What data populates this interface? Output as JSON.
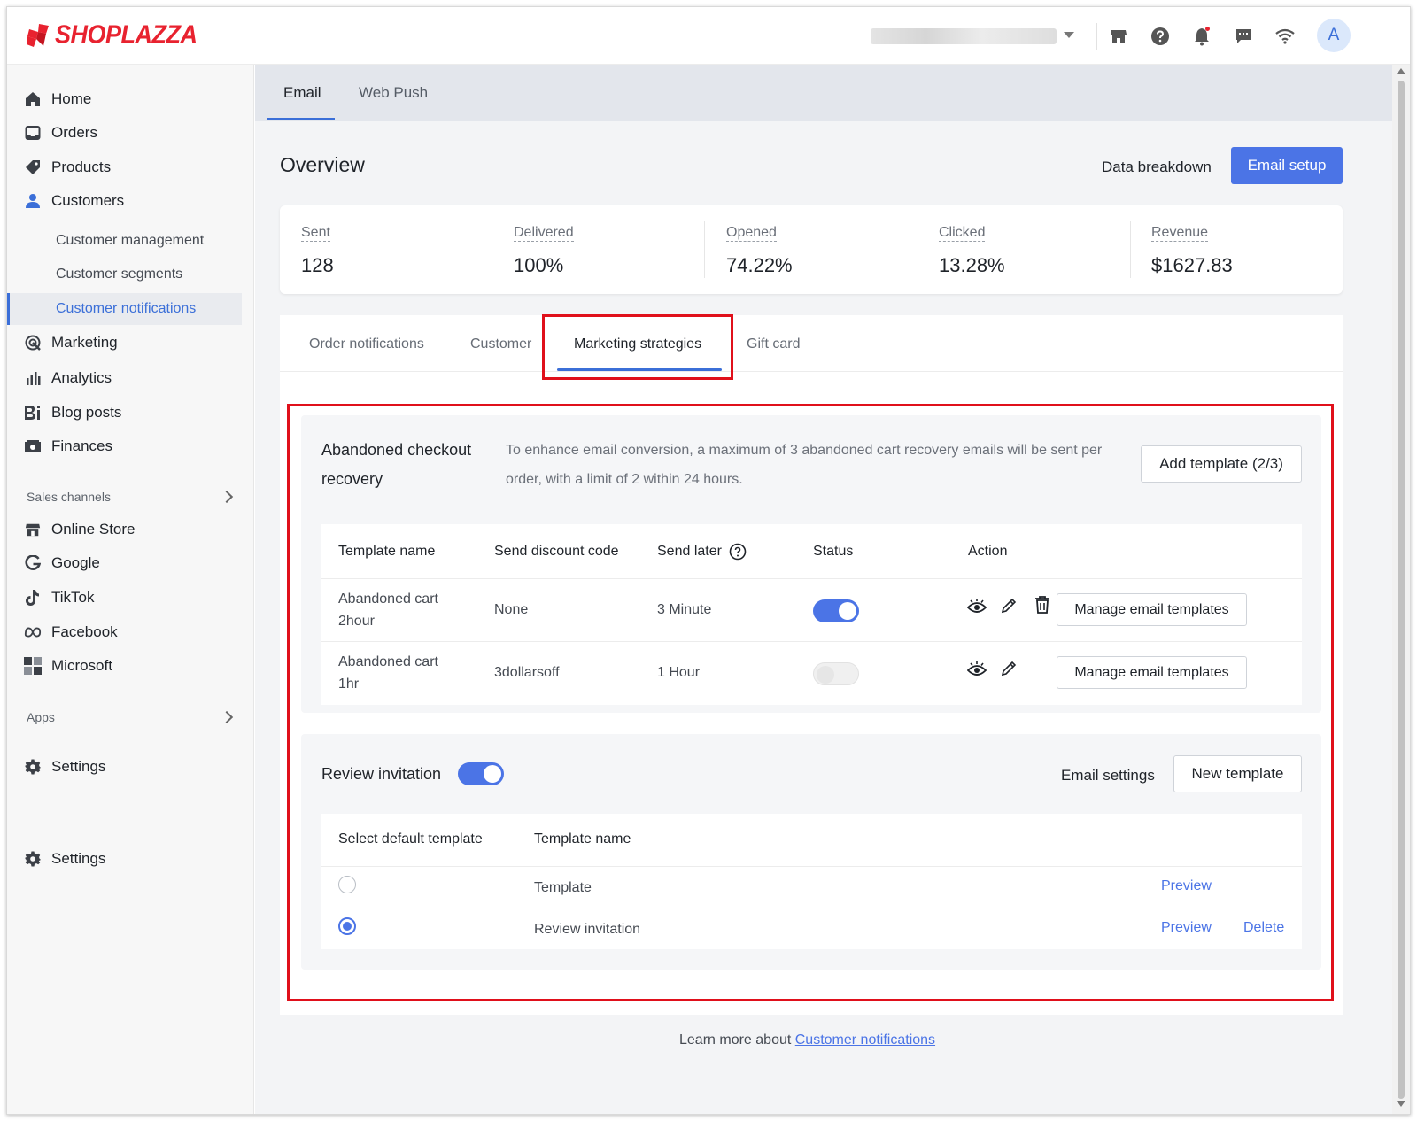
{
  "app": {
    "brand": "SHOPLAZZA",
    "colors": {
      "brand_red": "#e8222f",
      "accent_blue": "#4b74e6",
      "highlight_red": "#e0101b"
    }
  },
  "topbar": {
    "avatar_initial": "A",
    "icons": [
      "store-icon",
      "help-icon",
      "bell-icon",
      "chat-icon",
      "wifi-icon"
    ]
  },
  "sidebar": {
    "items": [
      {
        "label": "Home",
        "icon": "home-icon"
      },
      {
        "label": "Orders",
        "icon": "inbox-icon"
      },
      {
        "label": "Products",
        "icon": "tag-icon"
      },
      {
        "label": "Customers",
        "icon": "person-icon"
      }
    ],
    "customer_sub": [
      {
        "label": "Customer management"
      },
      {
        "label": "Customer segments"
      },
      {
        "label": "Customer notifications",
        "active": true
      }
    ],
    "items2": [
      {
        "label": "Marketing",
        "icon": "marketing-icon"
      },
      {
        "label": "Analytics",
        "icon": "analytics-icon"
      },
      {
        "label": "Blog posts",
        "icon": "blog-icon"
      },
      {
        "label": "Finances",
        "icon": "finances-icon"
      }
    ],
    "sales_channels_label": "Sales channels",
    "channels": [
      {
        "label": "Online Store",
        "icon": "store-icon"
      },
      {
        "label": "Google",
        "icon": "google-icon"
      },
      {
        "label": "TikTok",
        "icon": "tiktok-icon"
      },
      {
        "label": "Facebook",
        "icon": "meta-icon"
      },
      {
        "label": "Microsoft",
        "icon": "microsoft-icon"
      }
    ],
    "apps_label": "Apps",
    "settings_label": "Settings",
    "settings_label_2": "Settings"
  },
  "main": {
    "tabs": [
      {
        "label": "Email",
        "active": true
      },
      {
        "label": "Web Push"
      }
    ],
    "overview_title": "Overview",
    "data_breakdown": "Data breakdown",
    "email_setup": "Email setup",
    "stats": [
      {
        "label": "Sent",
        "value": "128"
      },
      {
        "label": "Delivered",
        "value": "100%"
      },
      {
        "label": "Opened",
        "value": "74.22%"
      },
      {
        "label": "Clicked",
        "value": "13.28%"
      },
      {
        "label": "Revenue",
        "value": "$1627.83"
      }
    ],
    "subtabs": [
      {
        "label": "Order notifications"
      },
      {
        "label": "Customer"
      },
      {
        "label": "Marketing strategies",
        "active": true
      },
      {
        "label": "Gift card"
      }
    ],
    "abandoned": {
      "title_line1": "Abandoned checkout",
      "title_line2": "recovery",
      "desc_line1": "To enhance email conversion, a maximum of 3 abandoned cart recovery emails will be sent per",
      "desc_line2": "order, with a limit of 2 within 24 hours.",
      "add_template": "Add template (2/3)",
      "headers": {
        "template_name": "Template name",
        "send_discount": "Send discount code",
        "send_later": "Send later",
        "status": "Status",
        "action": "Action"
      },
      "rows": [
        {
          "name_line1": "Abandoned cart",
          "name_line2": "2hour",
          "discount": "None",
          "later": "3 Minute",
          "enabled": true,
          "manage": "Manage email templates"
        },
        {
          "name_line1": "Abandoned cart",
          "name_line2": "1hr",
          "discount": "3dollarsoff",
          "later": "1 Hour",
          "enabled": false,
          "manage": "Manage email templates"
        }
      ]
    },
    "review": {
      "title": "Review invitation",
      "enabled": true,
      "email_settings": "Email settings",
      "new_template": "New template",
      "headers": {
        "select_default": "Select default template",
        "template_name": "Template name"
      },
      "rows": [
        {
          "name": "Template",
          "selected": false,
          "preview": "Preview"
        },
        {
          "name": "Review invitation",
          "selected": true,
          "preview": "Preview",
          "delete": "Delete"
        }
      ]
    },
    "footer": {
      "prefix": "Learn more about ",
      "link": "Customer notifications"
    }
  }
}
